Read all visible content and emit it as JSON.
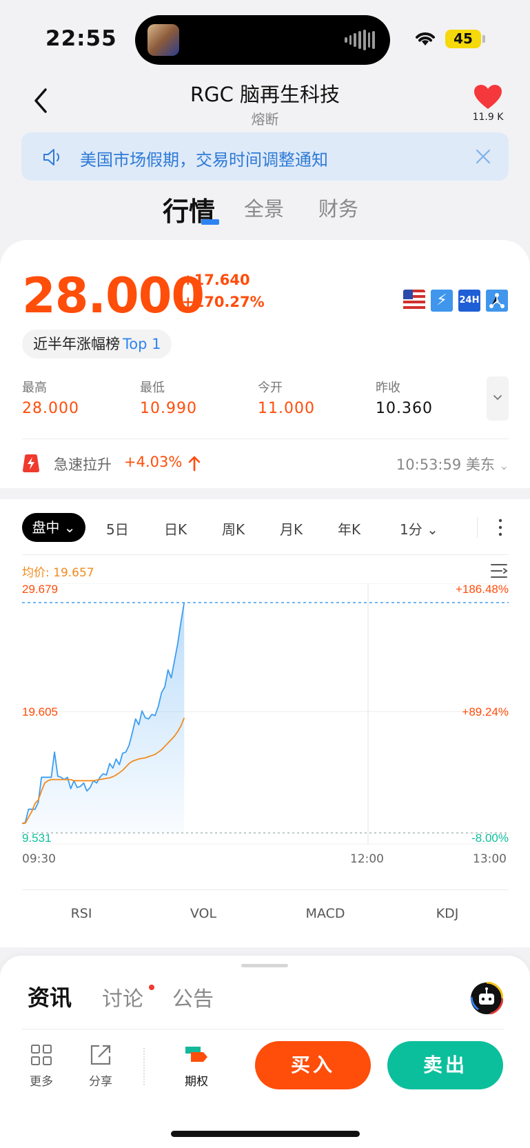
{
  "status_bar": {
    "time": "22:55",
    "battery": "45"
  },
  "header": {
    "title": "RGC 脑再生科技",
    "subtitle": "熔断",
    "favorite_count": "11.9 K"
  },
  "notice": {
    "text": "美国市场假期，交易时间调整通知"
  },
  "tabs": [
    {
      "label": "行情",
      "active": true
    },
    {
      "label": "全景",
      "active": false
    },
    {
      "label": "财务",
      "active": false
    }
  ],
  "quote": {
    "price": "28.000",
    "change_abs": "+17.640",
    "change_pct": "+170.27%",
    "rank_chip": {
      "label": "近半年涨幅榜",
      "rank": "Top 1"
    },
    "stats": [
      {
        "label": "最高",
        "value": "28.000"
      },
      {
        "label": "最低",
        "value": "10.990"
      },
      {
        "label": "今开",
        "value": "11.000"
      },
      {
        "label": "昨收",
        "value": "10.360"
      }
    ],
    "markers": [
      "us-flag-icon",
      "lightning-icon",
      "24h-icon",
      "nodes-icon"
    ],
    "alert": {
      "label": "急速拉升",
      "change": "+4.03%",
      "time": "10:53:59 美东"
    }
  },
  "chart_toolbar": {
    "periods": [
      "盘中",
      "5日",
      "日K",
      "周K",
      "月K",
      "年K",
      "1分"
    ],
    "active_period": "盘中"
  },
  "chart_data": {
    "type": "line",
    "avg_label": "均价: 19.657",
    "y_left_labels": [
      "29.679",
      "19.605",
      "9.531"
    ],
    "y_right_labels": [
      "+186.48%",
      "+89.24%",
      "-8.00%"
    ],
    "x_labels": [
      "09:30",
      "12:00",
      "13:00"
    ],
    "ylim": [
      9.531,
      29.679
    ],
    "x_range": [
      "09:30",
      "13:00"
    ],
    "series": [
      {
        "color": "#3d9df0",
        "values": [
          10.36,
          10.45,
          11.6,
          11.6,
          11.6,
          12.2,
          14.4,
          14.4,
          14.4,
          14.4,
          16.6,
          14.5,
          14.4,
          14.2,
          14.4,
          13.4,
          14.1,
          13.5,
          13.6,
          13.9,
          13.2,
          13.5,
          14.1,
          13.9,
          14.4,
          14.7,
          14.6,
          15.6,
          15.2,
          16.0,
          15.5,
          16.5,
          16.6,
          17.2,
          18.3,
          19.5,
          19.0,
          20.2,
          19.6,
          19.5,
          19.9,
          19.8,
          20.6,
          21.8,
          22.3,
          23.8,
          23.1,
          24.6,
          26.1,
          28.0,
          29.7
        ]
      },
      {
        "color": "#f28a1d",
        "values": [
          10.36,
          10.38,
          10.9,
          11.4,
          12.1,
          12.4,
          13.2,
          13.9,
          14.1,
          14.2,
          14.2,
          14.2,
          14.2,
          14.2,
          14.2,
          14.2,
          14.1,
          14.1,
          14.1,
          14.1,
          14.1,
          14.1,
          14.1,
          14.15,
          14.2,
          14.25,
          14.3,
          14.35,
          14.45,
          14.6,
          14.8,
          15.0,
          15.3,
          15.6,
          15.8,
          15.9,
          16.0,
          16.05,
          16.1,
          16.2,
          16.3,
          16.4,
          16.6,
          16.8,
          17.1,
          17.4,
          17.7,
          18.0,
          18.4,
          18.9,
          19.6
        ]
      }
    ]
  },
  "indicators": [
    "RSI",
    "VOL",
    "MACD",
    "KDJ"
  ],
  "bottom": {
    "tabs": [
      "资讯",
      "讨论",
      "公告"
    ],
    "more_label": "更多",
    "share_label": "分享",
    "options_label": "期权",
    "buy_label": "买入",
    "sell_label": "卖出"
  },
  "colors": {
    "up": "#ff4d0a",
    "down": "#0cbf9c",
    "accent": "#2e83f2",
    "avg": "#f28a1d"
  }
}
